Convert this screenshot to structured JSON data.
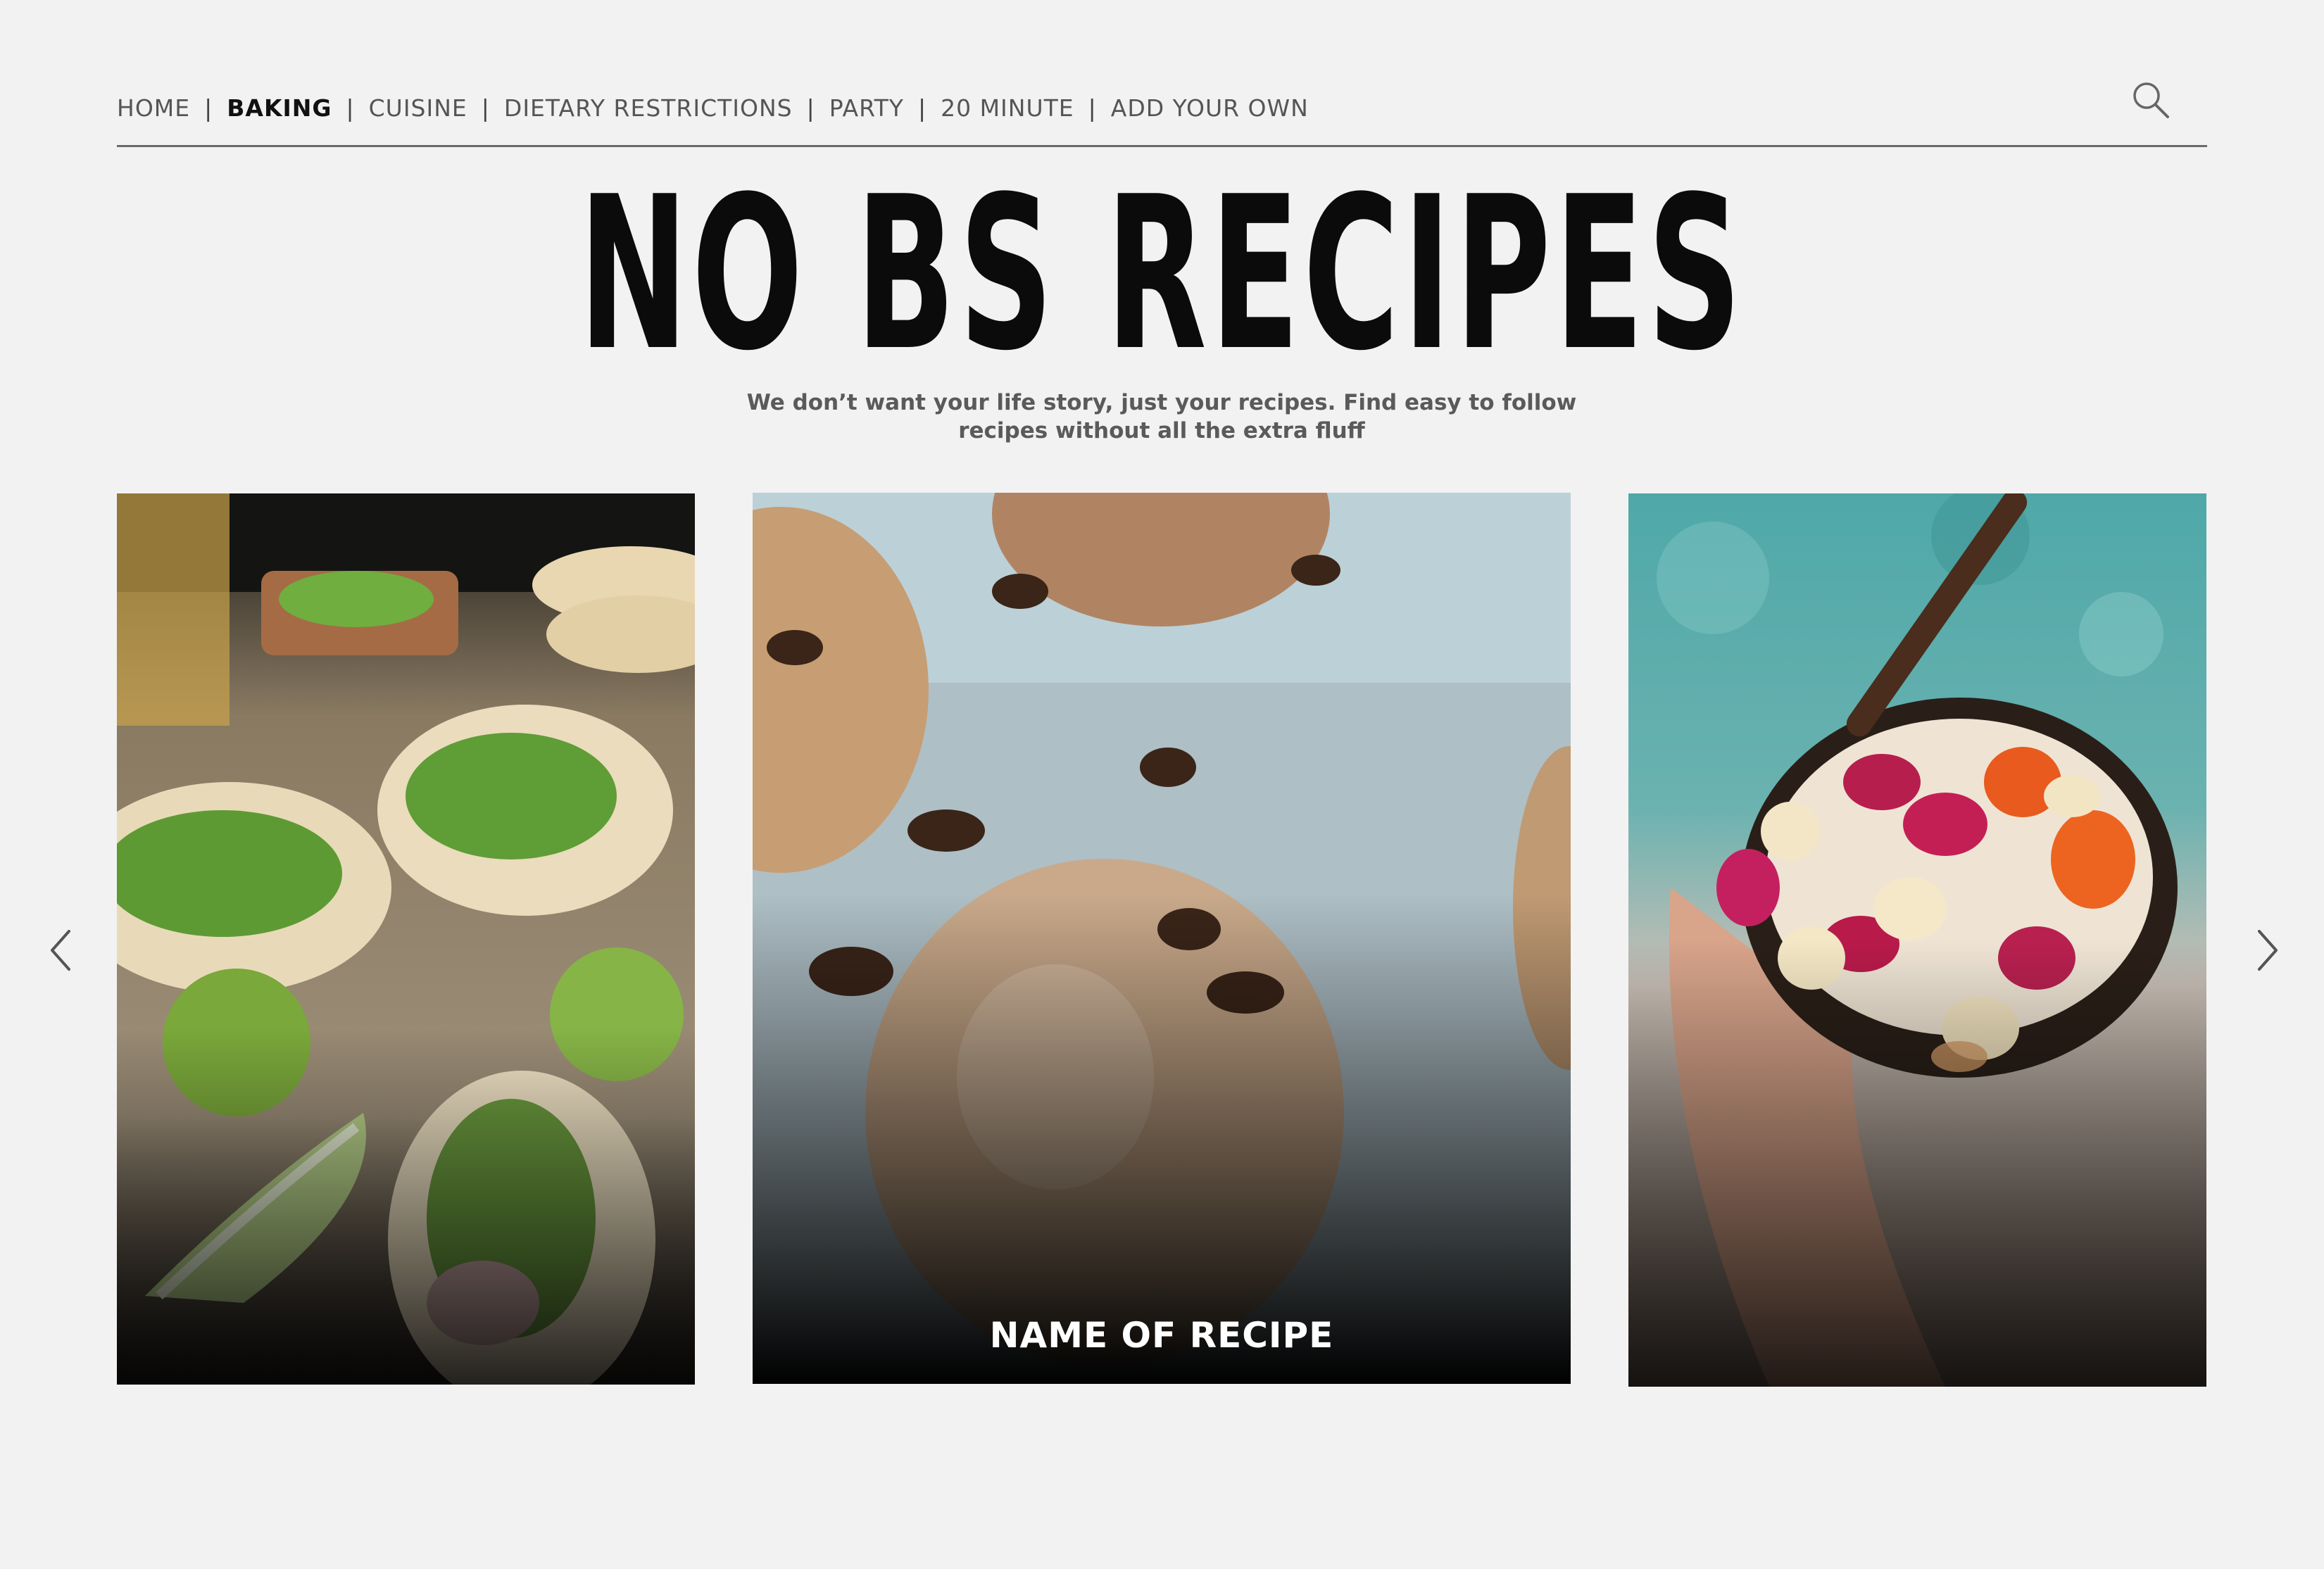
{
  "nav": {
    "items": [
      {
        "label": "HOME",
        "active": false
      },
      {
        "label": "BAKING",
        "active": true
      },
      {
        "label": "CUISINE",
        "active": false
      },
      {
        "label": "DIETARY RESTRICTIONS",
        "active": false
      },
      {
        "label": "PARTY",
        "active": false
      },
      {
        "label": "20 MINUTE",
        "active": false
      },
      {
        "label": "ADD YOUR OWN",
        "active": false
      }
    ],
    "separator": "|",
    "search_icon": "search-icon"
  },
  "hero": {
    "title": "NO BS RECIPES",
    "subtitle_line1": "We don’t want your life story, just your recipes. Find easy to follow",
    "subtitle_line2": "recipes without all the extra fluff"
  },
  "carousel": {
    "cards": [
      {
        "image": "tacos-image",
        "label": ""
      },
      {
        "image": "cookies-image",
        "label": "NAME OF RECIPE"
      },
      {
        "image": "smoothie-bowl-image",
        "label": ""
      }
    ],
    "prev_icon": "chevron-left-icon",
    "next_icon": "chevron-right-icon"
  },
  "colors": {
    "background": "#f2f2f2",
    "nav_text": "#555555",
    "nav_active": "#111111",
    "title": "#0b0b0b"
  }
}
